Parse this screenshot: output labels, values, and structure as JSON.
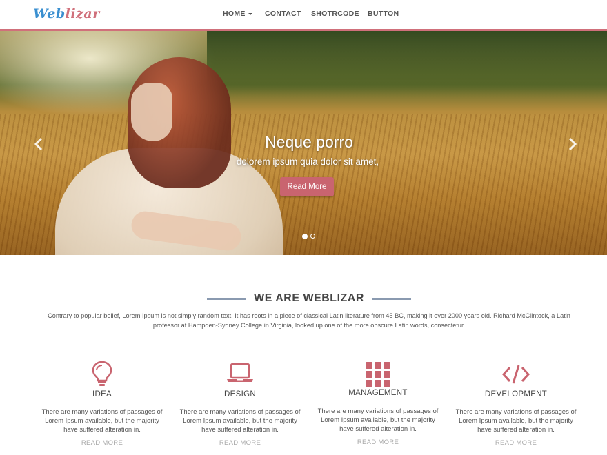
{
  "brand": {
    "part1": "Web",
    "part2": "lizar"
  },
  "nav": {
    "items": [
      {
        "label": "HOME",
        "has_caret": true
      },
      {
        "label": "CONTACT"
      },
      {
        "label": "SHOTRCODE"
      },
      {
        "label": "BUTTON"
      }
    ]
  },
  "hero": {
    "title": "Neque porro",
    "subtitle": "dolorem ipsum quia dolor sit amet,",
    "button_label": "Read More",
    "prev_icon": "chevron-left-icon",
    "next_icon": "chevron-right-icon",
    "slides_total": 2,
    "active_slide": 1
  },
  "section": {
    "title": "WE ARE WEBLIZAR",
    "description": "Contrary to popular belief, Lorem Ipsum is not simply random text. It has roots in a piece of classical Latin literature from 45 BC, making it over 2000 years old. Richard McClintock, a Latin professor at Hampden-Sydney College in Virginia, looked up one of the more obscure Latin words, consectetur."
  },
  "features": [
    {
      "icon": "lightbulb-icon",
      "title": "IDEA",
      "text": "There are many variations of passages of Lorem Ipsum available, but the majority have suffered alteration in.",
      "link": "READ MORE"
    },
    {
      "icon": "laptop-icon",
      "title": "DESIGN",
      "text": "There are many variations of passages of Lorem Ipsum available, but the majority have suffered alteration in.",
      "link": "READ MORE"
    },
    {
      "icon": "grid-icon",
      "title": "MANAGEMENT",
      "text": "There are many variations of passages of Lorem Ipsum available, but the majority have suffered alteration in.",
      "link": "READ MORE"
    },
    {
      "icon": "code-icon",
      "title": "DEVELOPMENT",
      "text": "There are many variations of passages of Lorem Ipsum available, but the majority have suffered alteration in.",
      "link": "READ MORE"
    }
  ],
  "colors": {
    "accent": "#c9646f",
    "brand_blue": "#3a8fd0",
    "brand_pink": "#d0707b",
    "icon": "#c9646f",
    "text": "#444444"
  }
}
